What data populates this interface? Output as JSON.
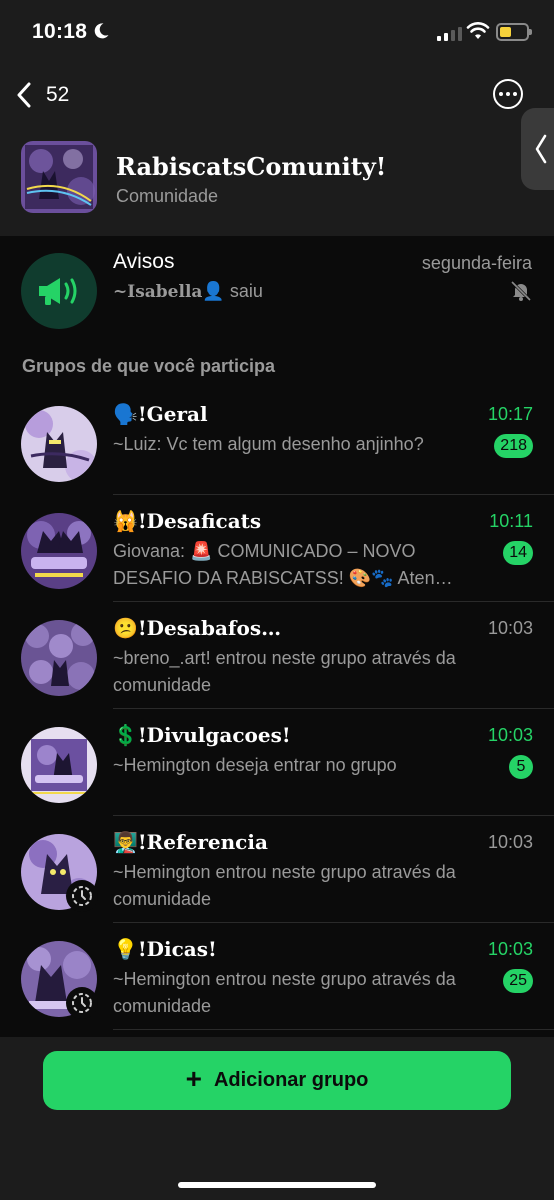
{
  "status_bar": {
    "time": "10:18"
  },
  "header": {
    "back_count": "52",
    "community_name": "RabiscatsComunity!",
    "community_subtitle": "Comunidade"
  },
  "announcements": {
    "title": "Avisos",
    "time": "segunda-feira",
    "sender": "~Isabella",
    "sender_emoji": "👤",
    "message": " saiu"
  },
  "section_title": "Grupos de que você participa",
  "groups": [
    {
      "emoji": "🗣️",
      "name": "!Geral",
      "time": "10:17",
      "unread": "218",
      "message": "~Luiz: Vc tem algum desenho anjinho?"
    },
    {
      "emoji": "🙀",
      "name": "!Desaficats",
      "time": "10:11",
      "unread": "14",
      "message": "Giovana: 🚨 COMUNICADO – NOVO DESAFIO DA RABISCATSS! 🎨🐾 Aten…"
    },
    {
      "emoji": "😕",
      "name": "!Desabafos…",
      "time": "10:03",
      "unread": "",
      "message": "~breno_.art! entrou neste grupo através da comunidade"
    },
    {
      "emoji": "💲",
      "name": "!Divulgacoes!",
      "time": "10:03",
      "unread": "5",
      "message": "~Hemington deseja entrar no grupo"
    },
    {
      "emoji": "👨‍🏫",
      "name": "!Referencia",
      "time": "10:03",
      "unread": "",
      "message": "~Hemington entrou neste grupo através da comunidade"
    },
    {
      "emoji": "💡",
      "name": "!Dicas!",
      "time": "10:03",
      "unread": "25",
      "message": "~Hemington entrou neste grupo através da comunidade"
    }
  ],
  "add_button_label": "Adicionar grupo",
  "colors": {
    "accent": "#25d366",
    "background": "#0b0b0b",
    "surface": "#1c1c1c",
    "muted_text": "#9a9a9a",
    "announce_icon_bg": "#103c2e"
  },
  "icons": [
    "moon-icon",
    "signal-icon",
    "wifi-icon",
    "battery-icon",
    "back-chevron-icon",
    "more-icon",
    "side-panel-chevron-icon",
    "megaphone-icon",
    "muted-bell-icon",
    "pending-timer-icon",
    "plus-icon"
  ]
}
